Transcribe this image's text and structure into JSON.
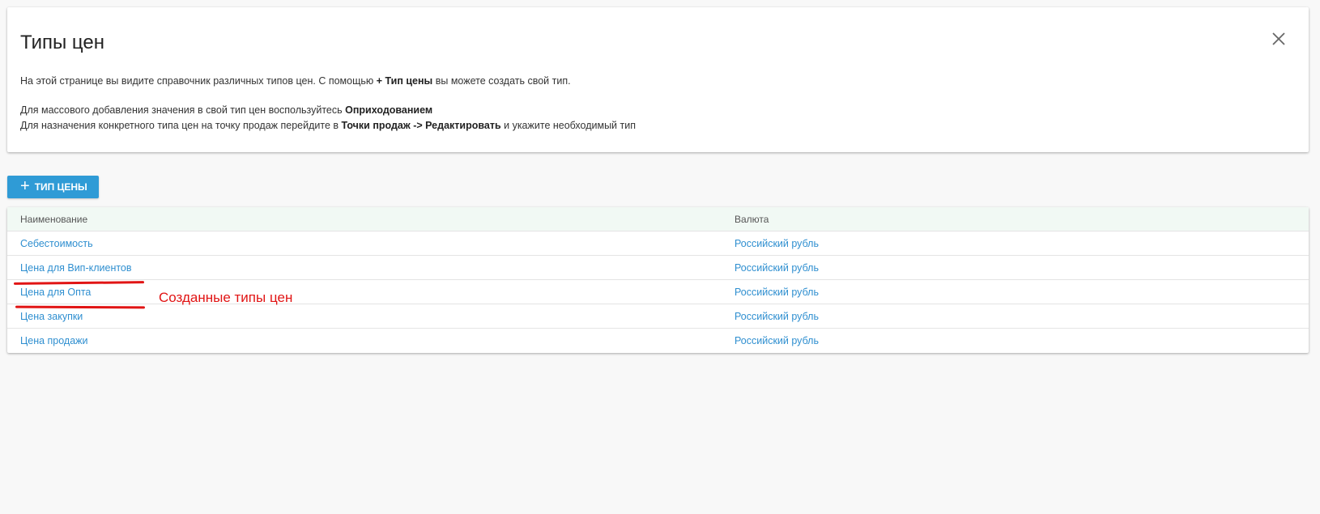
{
  "info": {
    "title": "Типы цен",
    "line1_prefix": "На этой странице вы видите справочник различных типов цен. С помощью ",
    "line1_bold": "+ Тип цены",
    "line1_suffix": " вы можете создать свой тип.",
    "line2_prefix": "Для массового добавления значения в свой тип цен воспользуйтесь ",
    "line2_bold": "Оприходованием",
    "line3_prefix": "Для назначения конкретного типа цен на точку продаж перейдите в ",
    "line3_bold": "Точки продаж -> Редактировать",
    "line3_suffix": " и укажите необходимый тип",
    "close_icon": "close-icon"
  },
  "toolbar": {
    "add_label": "ТИП ЦЕНЫ",
    "add_icon": "+"
  },
  "table": {
    "headers": {
      "name": "Наименование",
      "currency": "Валюта"
    },
    "rows": [
      {
        "name": "Себестоимость",
        "currency": "Российский рубль"
      },
      {
        "name": "Цена для Вип-клиентов",
        "currency": "Российский рубль"
      },
      {
        "name": "Цена для Опта",
        "currency": "Российский рубль"
      },
      {
        "name": "Цена закупки",
        "currency": "Российский рубль"
      },
      {
        "name": "Цена продажи",
        "currency": "Российский рубль"
      }
    ]
  },
  "annotation": {
    "text": "Созданные типы цен",
    "color": "#e11414"
  },
  "colors": {
    "accent": "#2f9bd6",
    "link": "#2f8fd0",
    "header_bg": "#f1f9f4"
  }
}
